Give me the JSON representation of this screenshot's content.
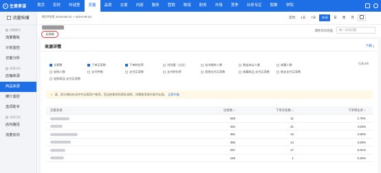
{
  "topbar": {
    "logo_text": "生意参谋",
    "nav": [
      {
        "label": "首页",
        "active": false
      },
      {
        "label": "实时",
        "active": false
      },
      {
        "label": "作战室",
        "active": false
      },
      {
        "label": "流量",
        "active": true
      },
      {
        "label": "品类",
        "active": false
      },
      {
        "label": "交易",
        "active": false
      },
      {
        "label": "内容",
        "active": false
      },
      {
        "label": "服务",
        "active": false
      },
      {
        "label": "营销",
        "active": false
      },
      {
        "label": "物流",
        "active": false
      },
      {
        "label": "财务",
        "active": false
      },
      {
        "label": "市场",
        "active": false
      },
      {
        "label": "竞争",
        "active": false
      },
      {
        "label": "业务专区",
        "active": false
      },
      {
        "label": "取数",
        "active": false
      },
      {
        "label": "学院",
        "active": false
      }
    ]
  },
  "sidebar": {
    "title": "流量纵横",
    "groups": [
      {
        "label": "流量概况",
        "items": [
          {
            "label": "流量看板",
            "active": false
          },
          {
            "label": "计划监控",
            "active": false
          },
          {
            "label": "访客分析",
            "active": false
          }
        ]
      },
      {
        "label": "来源分析",
        "items": [
          {
            "label": "店铺来源",
            "active": false
          },
          {
            "label": "商品来源",
            "active": true
          },
          {
            "label": "媒介监控",
            "active": false
          },
          {
            "label": "选词助手",
            "active": false
          }
        ]
      },
      {
        "label": "动线分析",
        "items": [
          {
            "label": "店内路径",
            "active": false
          },
          {
            "label": "流量去向",
            "active": false
          }
        ]
      }
    ]
  },
  "date_bar": {
    "text": "统计时间 2019-08-22 ~ 2019-09-20",
    "periods": [
      {
        "label": "实时",
        "active": false
      },
      {
        "label": "1天",
        "active": false
      },
      {
        "label": "7天",
        "active": false
      },
      {
        "label": "30天",
        "active": true
      },
      {
        "label": "日",
        "active": false
      },
      {
        "label": "周",
        "active": false
      },
      {
        "label": "月",
        "active": false
      }
    ]
  },
  "sub_bar": {
    "tag_label": "无线端",
    "compare_label": "请你对比商品",
    "compare_placeholder": "每一次的问题"
  },
  "card": {
    "title": "来源详情",
    "download": "下载",
    "selected_count": "已选 5/5",
    "metrics": [
      {
        "label": "访客数",
        "checked": true
      },
      {
        "label": "下单买家数",
        "checked": true
      },
      {
        "label": "下单转化率",
        "checked": true
      },
      {
        "label": "浏览量（占比）",
        "checked": false
      },
      {
        "label": "店内跳转人数",
        "checked": false
      },
      {
        "label": "跳出本店人数",
        "checked": false
      },
      {
        "label": "收藏人数",
        "checked": false
      },
      {
        "label": "",
        "checked": false
      },
      {
        "label": "加购人数",
        "checked": false
      },
      {
        "label": "支付件数",
        "checked": false
      },
      {
        "label": "支付买家数",
        "checked": false
      },
      {
        "label": "支付转化率",
        "checked": false
      },
      {
        "label": "直接支付买家数",
        "checked": false
      },
      {
        "label": "收藏商品-支付买家数",
        "checked": false
      },
      {
        "label": "粉丝支付买家数",
        "checked": false
      },
      {
        "label": "",
        "checked": false
      },
      {
        "label": "加购商品-支付买家数",
        "checked": false
      },
      {
        "label": "",
        "checked": false
      }
    ],
    "notice": {
      "text": "温、部分指标仅支持专业版用户使用，您当前使用的是标准版，如需使用请升级专业版。",
      "link": "立即升级"
    },
    "table": {
      "headers": [
        "流量来源",
        "访客数",
        "下单买家数",
        "下单转化率"
      ],
      "rows": [
        {
          "visitors": "648",
          "buyers": "11",
          "rate": "1.70%"
        },
        {
          "visitors": "454",
          "buyers": "21",
          "rate": "4.63%"
        },
        {
          "visitors": "361",
          "buyers": "13",
          "rate": "3.60%"
        },
        {
          "visitors": "356",
          "buyers": "14",
          "rate": "3.93%"
        },
        {
          "visitors": "257",
          "buyers": "17",
          "rate": "6.61%"
        },
        {
          "visitors": "249",
          "buyers": "1",
          "rate": "0.40%"
        }
      ]
    }
  }
}
